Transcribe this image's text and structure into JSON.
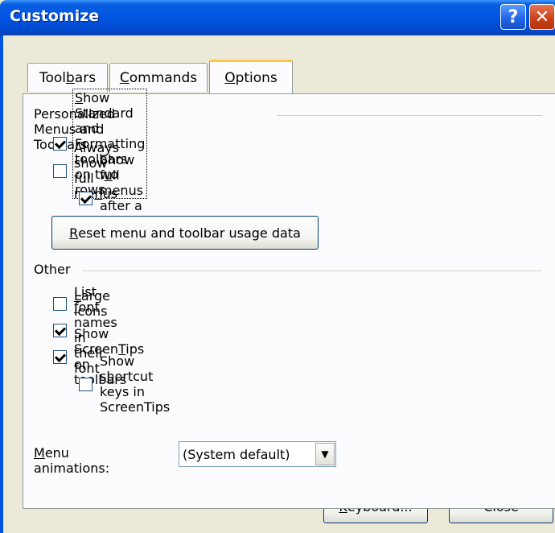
{
  "window": {
    "title": "Customize",
    "help_glyph": "?",
    "close_glyph": "✕"
  },
  "tabs": [
    {
      "pre": "Tool",
      "u": "b",
      "post": "ars"
    },
    {
      "pre": "",
      "u": "C",
      "post": "ommands"
    },
    {
      "pre": "",
      "u": "O",
      "post": "ptions"
    }
  ],
  "active_tab": "Options",
  "personalized": {
    "heading": "Personalized Menus and Toolbars",
    "two_rows": {
      "pre": "",
      "u": "S",
      "post": "how Standard and Formatting toolbars on two rows",
      "checked": true
    },
    "full_menus": {
      "pre": "Always show full me",
      "u": "n",
      "post": "us",
      "checked": false
    },
    "short_delay": {
      "pre": "Show f",
      "u": "u",
      "post": "ll menus after a short delay",
      "checked": true
    },
    "reset_button": {
      "pre": "",
      "u": "R",
      "post": "eset menu and toolbar usage data"
    }
  },
  "other": {
    "heading": "Other",
    "large_icons": {
      "pre": "",
      "u": "L",
      "post": "arge icons",
      "checked": false
    },
    "font_names": {
      "pre": "List ",
      "u": "f",
      "post": "ont names in their font",
      "checked": true
    },
    "screentips": {
      "pre": "Show Screen",
      "u": "T",
      "post": "ips on toolbars",
      "checked": true
    },
    "shortcut_keys": {
      "pre": "Show s",
      "u": "h",
      "post": "ortcut keys in ScreenTips",
      "checked": false
    },
    "menu_animations": {
      "pre": "",
      "u": "M",
      "post": "enu animations:",
      "value": "(System default)"
    }
  },
  "footer": {
    "keyboard": {
      "pre": "",
      "u": "K",
      "post": "eyboard..."
    },
    "close": "Close"
  }
}
